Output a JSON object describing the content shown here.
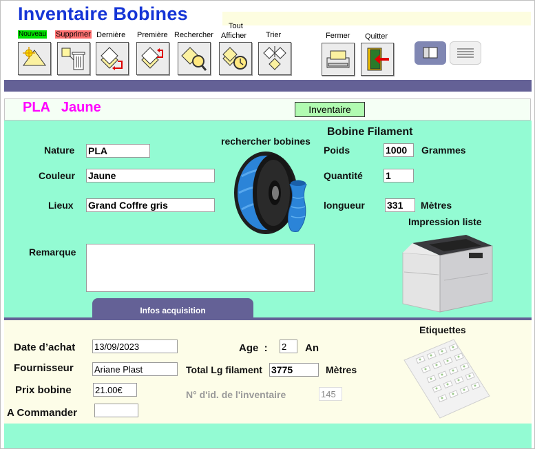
{
  "app": {
    "title": "Inventaire Bobines"
  },
  "toolbar": {
    "nouveau": "Nouveau",
    "supprimer": "Supprimer",
    "derniere": "Dernière",
    "premiere": "Première",
    "rechercher": "Rechercher",
    "tout_afficher_1": "Tout",
    "tout_afficher_2": "Afficher",
    "trier": "Trier",
    "fermer": "Fermer",
    "quitter": "Quitter"
  },
  "header": {
    "record_title": "PLA   Jaune",
    "inventaire_button": "Inventaire"
  },
  "form": {
    "nature_label": "Nature",
    "nature_value": "PLA",
    "couleur_label": "Couleur",
    "couleur_value": "Jaune",
    "lieux_label": "Lieux",
    "lieux_value": "Grand Coffre gris",
    "remarque_label": "Remarque",
    "remarque_value": "",
    "rechercher_bobines": "rechercher bobines",
    "bobine_filament": "Bobine Filament",
    "poids_label": "Poids",
    "poids_value": "1000",
    "poids_unit": "Grammes",
    "quantite_label": "Quantité",
    "quantite_value": "1",
    "longueur_label": "longueur",
    "longueur_value": "331",
    "longueur_unit": "Mètres",
    "impression_liste": "Impression liste",
    "infos_tab": "Infos acquisition"
  },
  "acquisition": {
    "date_label": "Date d’achat",
    "date_value": "13/09/2023",
    "fournisseur_label": "Fournisseur",
    "fournisseur_value": "Ariane Plast",
    "prix_label": "Prix bobine",
    "prix_value": "21.00€",
    "commander_label": "A Commander",
    "commander_value": "",
    "age_label": "Age  :",
    "age_value": "2",
    "age_unit": "An",
    "total_label": "Total Lg filament",
    "total_value": "3775",
    "total_unit": "Mètres",
    "id_label": "N° d'id. de l'inventaire",
    "id_value": "145",
    "etiquettes": "Etiquettes"
  },
  "colors": {
    "title_blue": "#1535d6",
    "green_bg": "#93fbd3",
    "purple": "#646196",
    "magenta": "#ff00ff",
    "nouveau_bg": "#00e000",
    "supprimer_bg": "#ff7070"
  }
}
